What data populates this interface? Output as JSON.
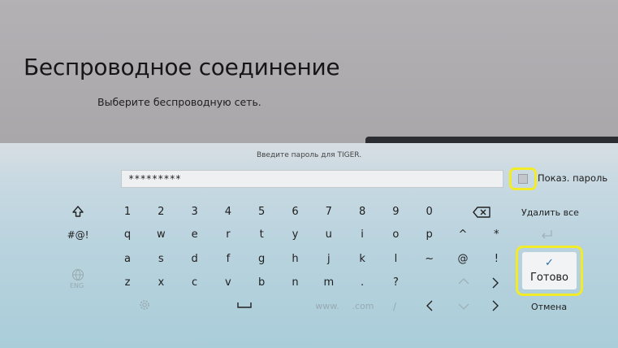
{
  "header": {
    "title": "Беспроводное соединение",
    "subtitle": "Выберите беспроводную сеть."
  },
  "password_dialog": {
    "prompt": "Введите пароль для TIGER.",
    "password_value": "*********",
    "show_password_label": "Показ. пароль",
    "show_password_checked": false
  },
  "keyboard": {
    "row_numbers": [
      "1",
      "2",
      "3",
      "4",
      "5",
      "6",
      "7",
      "8",
      "9",
      "0"
    ],
    "row_q": [
      "q",
      "w",
      "e",
      "r",
      "t",
      "y",
      "u",
      "i",
      "o",
      "p",
      "^",
      "*"
    ],
    "row_a": [
      "a",
      "s",
      "d",
      "f",
      "g",
      "h",
      "j",
      "k",
      "l",
      "~",
      "@",
      "!"
    ],
    "row_z": [
      "z",
      "x",
      "c",
      "v",
      "b",
      "n",
      "m",
      ".",
      "?"
    ],
    "symbols_key": "#@!",
    "lang_label": "ENG",
    "www_key": "www.",
    "com_key": ".com",
    "slash_key": "/"
  },
  "actions": {
    "delete_all": "Удалить все",
    "done": "Готово",
    "cancel": "Отмена"
  },
  "colors": {
    "highlight": "#f2ec28",
    "panel": "#b9d3de",
    "check": "#2a6fa8"
  }
}
